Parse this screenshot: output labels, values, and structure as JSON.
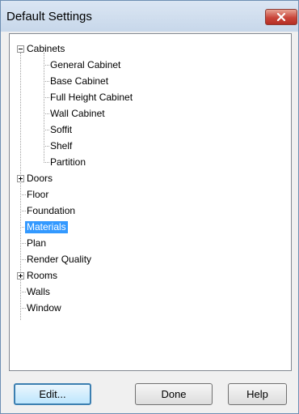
{
  "window": {
    "title": "Default Settings"
  },
  "tree": {
    "cabinets": {
      "label": "Cabinets",
      "children": [
        "General Cabinet",
        "Base Cabinet",
        "Full Height Cabinet",
        "Wall Cabinet",
        "Soffit",
        "Shelf",
        "Partition"
      ]
    },
    "items": [
      "Doors",
      "Floor",
      "Foundation",
      "Materials",
      "Plan",
      "Render Quality",
      "Rooms",
      "Walls",
      "Window"
    ],
    "selected": "Materials"
  },
  "buttons": {
    "edit": "Edit...",
    "done": "Done",
    "help": "Help"
  }
}
